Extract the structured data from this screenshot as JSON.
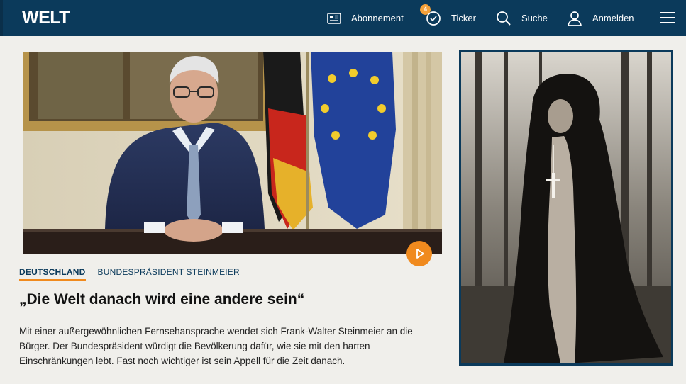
{
  "header": {
    "logo": "WELT",
    "nav": {
      "subscription_label": "Abonnement",
      "ticker_label": "Ticker",
      "ticker_badge": "4",
      "search_label": "Suche",
      "login_label": "Anmelden"
    },
    "icons": [
      "newspaper-icon",
      "clock-check-icon",
      "search-icon",
      "user-icon",
      "menu-icon"
    ]
  },
  "article": {
    "section": "DEUTSCHLAND",
    "topic": "BUNDESPRÄSIDENT STEINMEIER",
    "headline": "„Die Welt danach wird eine andere sein“",
    "teaser": "Mit einer außergewöhnlichen Fernsehansprache wendet sich Frank-Walter Steinmeier an die Bürger. Der Bundespräsident würdigt die Bevölkerung dafür, wie sie mit den harten Einschränkungen lebt. Fast noch wichtiger ist sein Appell für die Zeit danach.",
    "has_video": true
  },
  "colors": {
    "brand_navy": "#0b3a5b",
    "accent_orange": "#f08a1e",
    "badge_orange": "#f5a13a",
    "page_background": "#f0efeb"
  }
}
